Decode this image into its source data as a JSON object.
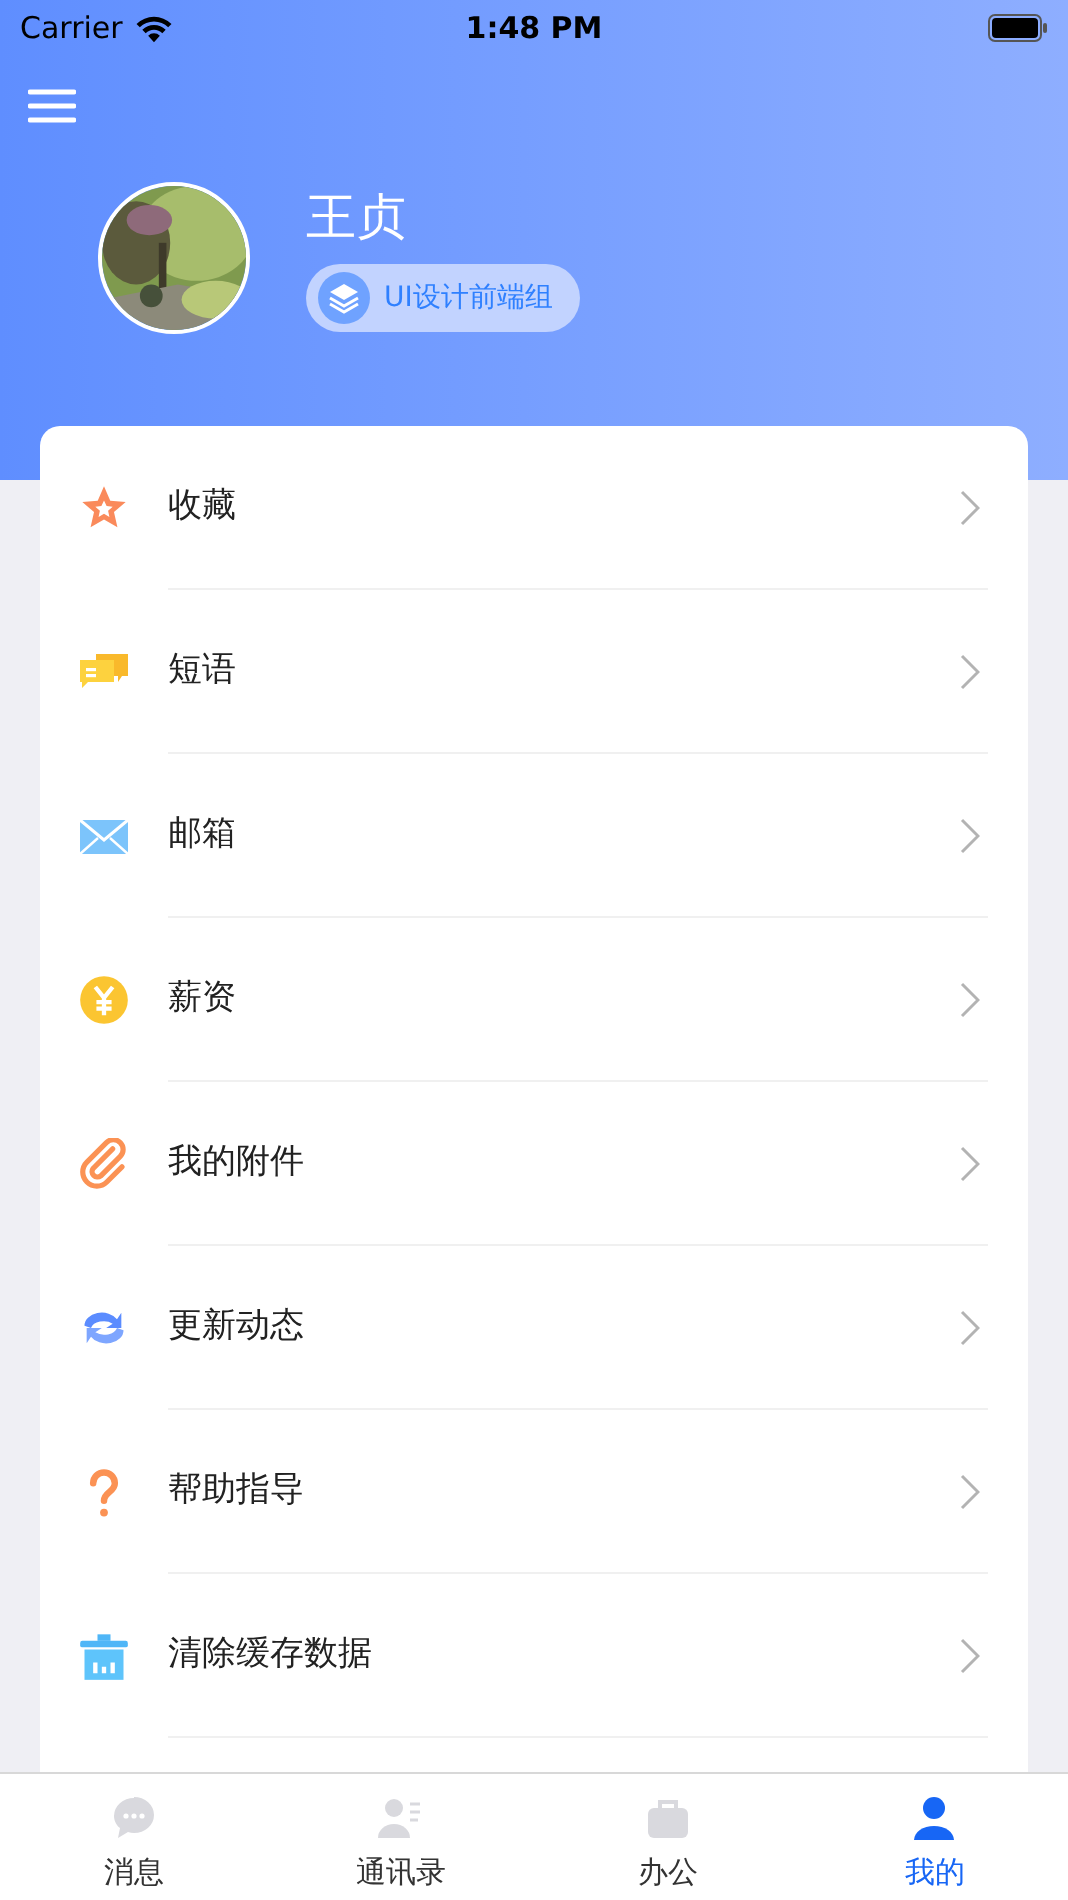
{
  "status_bar": {
    "carrier": "Carrier",
    "time": "1:48 PM"
  },
  "profile": {
    "name": "王贞",
    "department": "UI设计前端组"
  },
  "menu": [
    {
      "label": "收藏"
    },
    {
      "label": "短语"
    },
    {
      "label": "邮箱"
    },
    {
      "label": "薪资"
    },
    {
      "label": "我的附件"
    },
    {
      "label": "更新动态"
    },
    {
      "label": "帮助指导"
    },
    {
      "label": "清除缓存数据"
    }
  ],
  "tab_bar": [
    {
      "label": "消息",
      "selected": false
    },
    {
      "label": "通讯录",
      "selected": false
    },
    {
      "label": "办公",
      "selected": false
    },
    {
      "label": "我的",
      "selected": true
    }
  ]
}
